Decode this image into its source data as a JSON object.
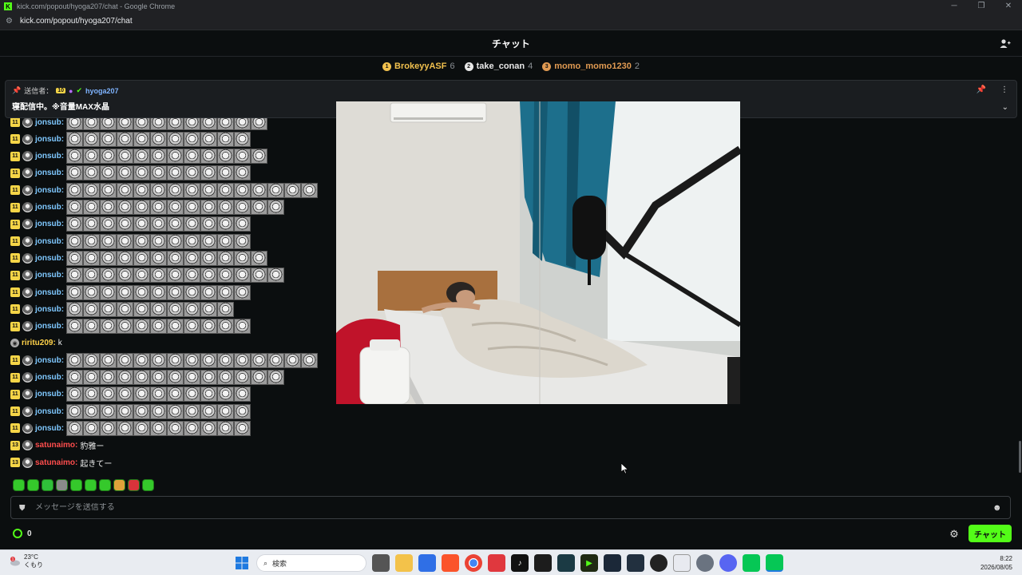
{
  "browser": {
    "window_title": "kick.com/popout/hyoga207/chat - Google Chrome",
    "url": "kick.com/popout/hyoga207/chat"
  },
  "header": {
    "title": "チャット"
  },
  "leaderboard": [
    {
      "rank": "1",
      "name": "BrokeyyASF",
      "count": "6",
      "color": "#f2c14e"
    },
    {
      "rank": "2",
      "name": "take_conan",
      "count": "4",
      "color": "#e8e8e8"
    },
    {
      "rank": "3",
      "name": "momo_momo1230",
      "count": "2",
      "color": "#e09a52"
    }
  ],
  "pinned": {
    "label": "送信者：",
    "badge": "10",
    "author": "hyoga207",
    "message": "寝配信中。※音量MAX水晶"
  },
  "messages": [
    {
      "badge": "11",
      "user": "jonsub:",
      "user_color": "#7fc8ff",
      "emotes": 12
    },
    {
      "badge": "11",
      "user": "jonsub:",
      "user_color": "#7fc8ff",
      "emotes": 11
    },
    {
      "badge": "11",
      "user": "jonsub:",
      "user_color": "#7fc8ff",
      "emotes": 12
    },
    {
      "badge": "11",
      "user": "jonsub:",
      "user_color": "#7fc8ff",
      "emotes": 11
    },
    {
      "badge": "11",
      "user": "jonsub:",
      "user_color": "#7fc8ff",
      "emotes": 15
    },
    {
      "badge": "11",
      "user": "jonsub:",
      "user_color": "#7fc8ff",
      "emotes": 13
    },
    {
      "badge": "11",
      "user": "jonsub:",
      "user_color": "#7fc8ff",
      "emotes": 11
    },
    {
      "badge": "11",
      "user": "jonsub:",
      "user_color": "#7fc8ff",
      "emotes": 11
    },
    {
      "badge": "11",
      "user": "jonsub:",
      "user_color": "#7fc8ff",
      "emotes": 12
    },
    {
      "badge": "11",
      "user": "jonsub:",
      "user_color": "#7fc8ff",
      "emotes": 13
    },
    {
      "badge": "11",
      "user": "jonsub:",
      "user_color": "#7fc8ff",
      "emotes": 11
    },
    {
      "badge": "11",
      "user": "jonsub:",
      "user_color": "#7fc8ff",
      "emotes": 10
    },
    {
      "badge": "11",
      "user": "jonsub:",
      "user_color": "#7fc8ff",
      "emotes": 11
    },
    {
      "badge": "",
      "user": "riritu209:",
      "user_color": "#ffd24a",
      "text": "k"
    },
    {
      "badge": "11",
      "user": "jonsub:",
      "user_color": "#7fc8ff",
      "emotes": 15
    },
    {
      "badge": "11",
      "user": "jonsub:",
      "user_color": "#7fc8ff",
      "emotes": 13
    },
    {
      "badge": "11",
      "user": "jonsub:",
      "user_color": "#7fc8ff",
      "emotes": 11
    },
    {
      "badge": "11",
      "user": "jonsub:",
      "user_color": "#7fc8ff",
      "emotes": 11
    },
    {
      "badge": "11",
      "user": "jonsub:",
      "user_color": "#7fc8ff",
      "emotes": 11
    },
    {
      "badge": "13",
      "user": "satunaimo:",
      "user_color": "#ff4d4d",
      "text": "豹雅ー"
    },
    {
      "badge": "13",
      "user": "satunaimo:",
      "user_color": "#ff4d4d",
      "text": "起きてー"
    }
  ],
  "input": {
    "placeholder": "メッセージを送信する"
  },
  "points": {
    "value": "0"
  },
  "send_button": "チャット",
  "taskbar": {
    "weather_temp": "23°C",
    "weather_desc": "くもり",
    "weather_alert": "1",
    "search_placeholder": "検索",
    "time": "8:22",
    "date": "2026/08/05"
  }
}
